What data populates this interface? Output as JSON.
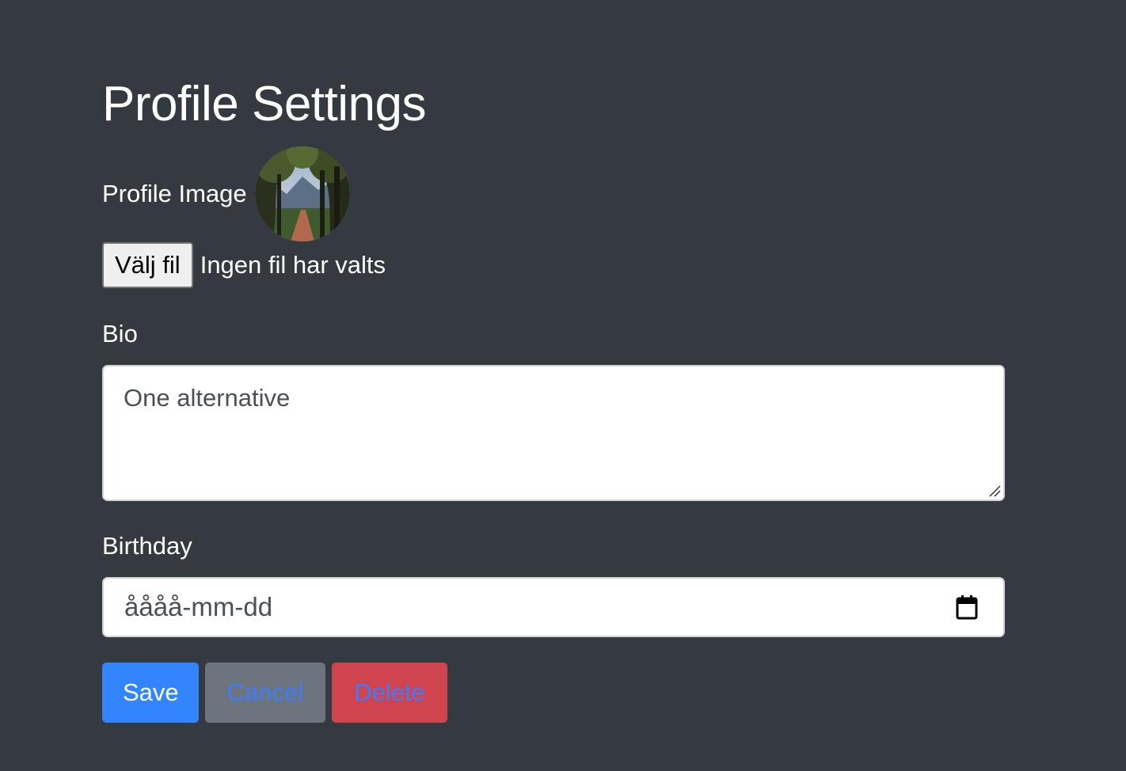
{
  "page": {
    "title": "Profile Settings"
  },
  "profile_image": {
    "label": "Profile Image"
  },
  "file_input": {
    "button_label": "Välj fil",
    "status": "Ingen fil har valts"
  },
  "bio": {
    "label": "Bio",
    "value": "One alternative"
  },
  "birthday": {
    "label": "Birthday",
    "placeholder": "åååå-mm-dd",
    "icon": "calendar-icon"
  },
  "actions": {
    "save_label": "Save",
    "cancel_label": "Cancel",
    "delete_label": "Delete"
  },
  "colors": {
    "background": "#343a40",
    "save": "#3284ff",
    "cancel": "#6c757d",
    "delete": "#d0444f",
    "link_text": "#3d7bff"
  }
}
